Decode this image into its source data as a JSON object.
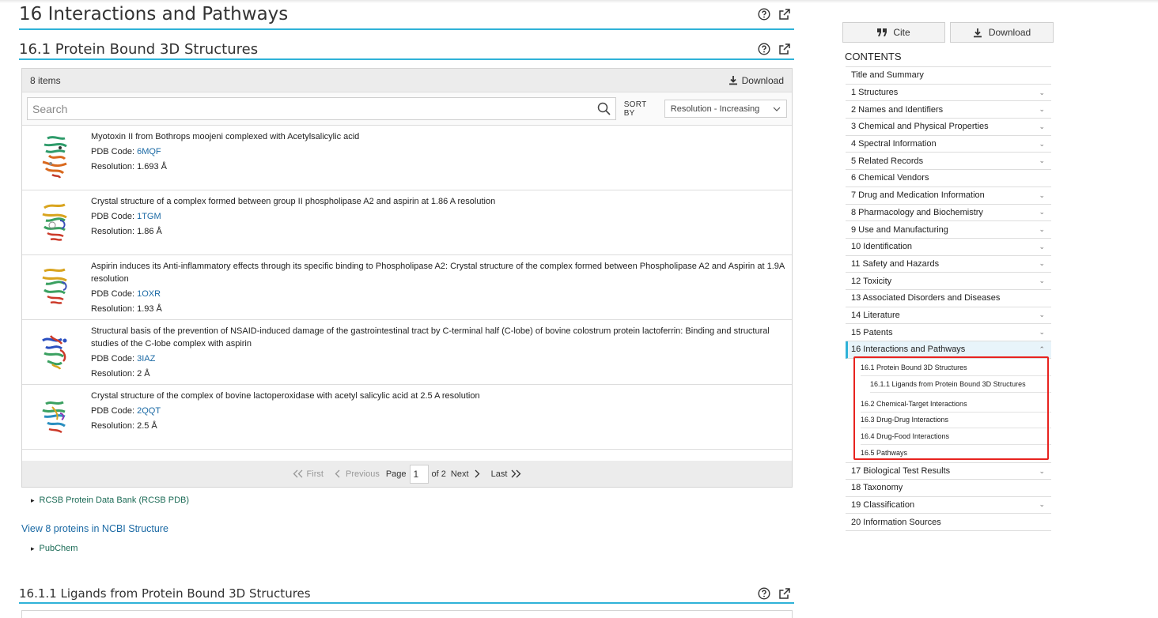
{
  "section": {
    "title": "16 Interactions and Pathways",
    "subsection_title": "16.1 Protein Bound 3D Structures",
    "next_subsection_title": "16.1.1 Ligands from Protein Bound 3D Structures"
  },
  "panel": {
    "count_label": "8 items",
    "download_label": "Download",
    "search_placeholder": "Search",
    "sort_by_label": "SORT BY",
    "sort_value": "Resolution - Increasing"
  },
  "items": [
    {
      "title": "Myotoxin II from Bothrops moojeni complexed with Acetylsalicylic acid",
      "pdb_label": "PDB Code: ",
      "pdb_code": "6MQF",
      "resolution": "Resolution: 1.693 Å"
    },
    {
      "title": "Crystal structure of a complex formed between group II phospholipase A2 and aspirin at 1.86 A resolution",
      "pdb_label": "PDB Code: ",
      "pdb_code": "1TGM",
      "resolution": "Resolution: 1.86 Å"
    },
    {
      "title": "Aspirin induces its Anti-inflammatory effects through its specific binding to Phospholipase A2: Crystal structure of the complex formed between Phospholipase A2 and Aspirin at 1.9A resolution",
      "pdb_label": "PDB Code: ",
      "pdb_code": "1OXR",
      "resolution": "Resolution: 1.93 Å"
    },
    {
      "title": "Structural basis of the prevention of NSAID-induced damage of the gastrointestinal tract by C-terminal half (C-lobe) of bovine colostrum protein lactoferrin: Binding and structural studies of the C-lobe complex with aspirin",
      "pdb_label": "PDB Code: ",
      "pdb_code": "3IAZ",
      "resolution": "Resolution: 2 Å"
    },
    {
      "title": "Crystal structure of the complex of bovine lactoperoxidase with acetyl salicylic acid at 2.5 A resolution",
      "pdb_label": "PDB Code: ",
      "pdb_code": "2QQT",
      "resolution": "Resolution: 2.5 Å"
    }
  ],
  "pager": {
    "first": "First",
    "previous": "Previous",
    "page_label": "Page",
    "page_value": "1",
    "of_label": "of 2",
    "next": "Next",
    "last": "Last"
  },
  "links": {
    "rcsb": "RCSB Protein Data Bank (RCSB PDB)",
    "view_ncbi": "View 8 proteins in NCBI Structure",
    "pubchem": "PubChem"
  },
  "sidebar": {
    "cite_label": "Cite",
    "download_label": "Download",
    "contents_heading": "CONTENTS",
    "toc_before": [
      {
        "label": "Title and Summary",
        "chev": ""
      },
      {
        "label": "1 Structures",
        "chev": "⌄"
      },
      {
        "label": "2 Names and Identifiers",
        "chev": "⌄"
      },
      {
        "label": "3 Chemical and Physical Properties",
        "chev": "⌄"
      },
      {
        "label": "4 Spectral Information",
        "chev": "⌄"
      },
      {
        "label": "5 Related Records",
        "chev": "⌄"
      },
      {
        "label": "6 Chemical Vendors",
        "chev": ""
      },
      {
        "label": "7 Drug and Medication Information",
        "chev": "⌄"
      },
      {
        "label": "8 Pharmacology and Biochemistry",
        "chev": "⌄"
      },
      {
        "label": "9 Use and Manufacturing",
        "chev": "⌄"
      },
      {
        "label": "10 Identification",
        "chev": "⌄"
      },
      {
        "label": "11 Safety and Hazards",
        "chev": "⌄"
      },
      {
        "label": "12 Toxicity",
        "chev": "⌄"
      },
      {
        "label": "13 Associated Disorders and Diseases",
        "chev": ""
      },
      {
        "label": "14 Literature",
        "chev": "⌄"
      },
      {
        "label": "15 Patents",
        "chev": "⌄"
      }
    ],
    "toc_active": {
      "label": "16 Interactions and Pathways",
      "chev": "⌃"
    },
    "toc_sub": [
      {
        "label": "16.1 Protein Bound 3D Structures"
      },
      {
        "label": "16.1.1 Ligands from Protein Bound 3D Structures"
      },
      {
        "label": "16.2 Chemical-Target Interactions"
      },
      {
        "label": "16.3 Drug-Drug Interactions"
      },
      {
        "label": "16.4 Drug-Food Interactions"
      },
      {
        "label": "16.5 Pathways"
      }
    ],
    "toc_after": [
      {
        "label": "17 Biological Test Results",
        "chev": "⌄"
      },
      {
        "label": "18 Taxonomy",
        "chev": ""
      },
      {
        "label": "19 Classification",
        "chev": "⌄"
      },
      {
        "label": "20 Information Sources",
        "chev": ""
      }
    ]
  },
  "colors": {
    "accent": "#2fb2d8",
    "link": "#1a69a4",
    "highlight_box": "#e8231f"
  }
}
